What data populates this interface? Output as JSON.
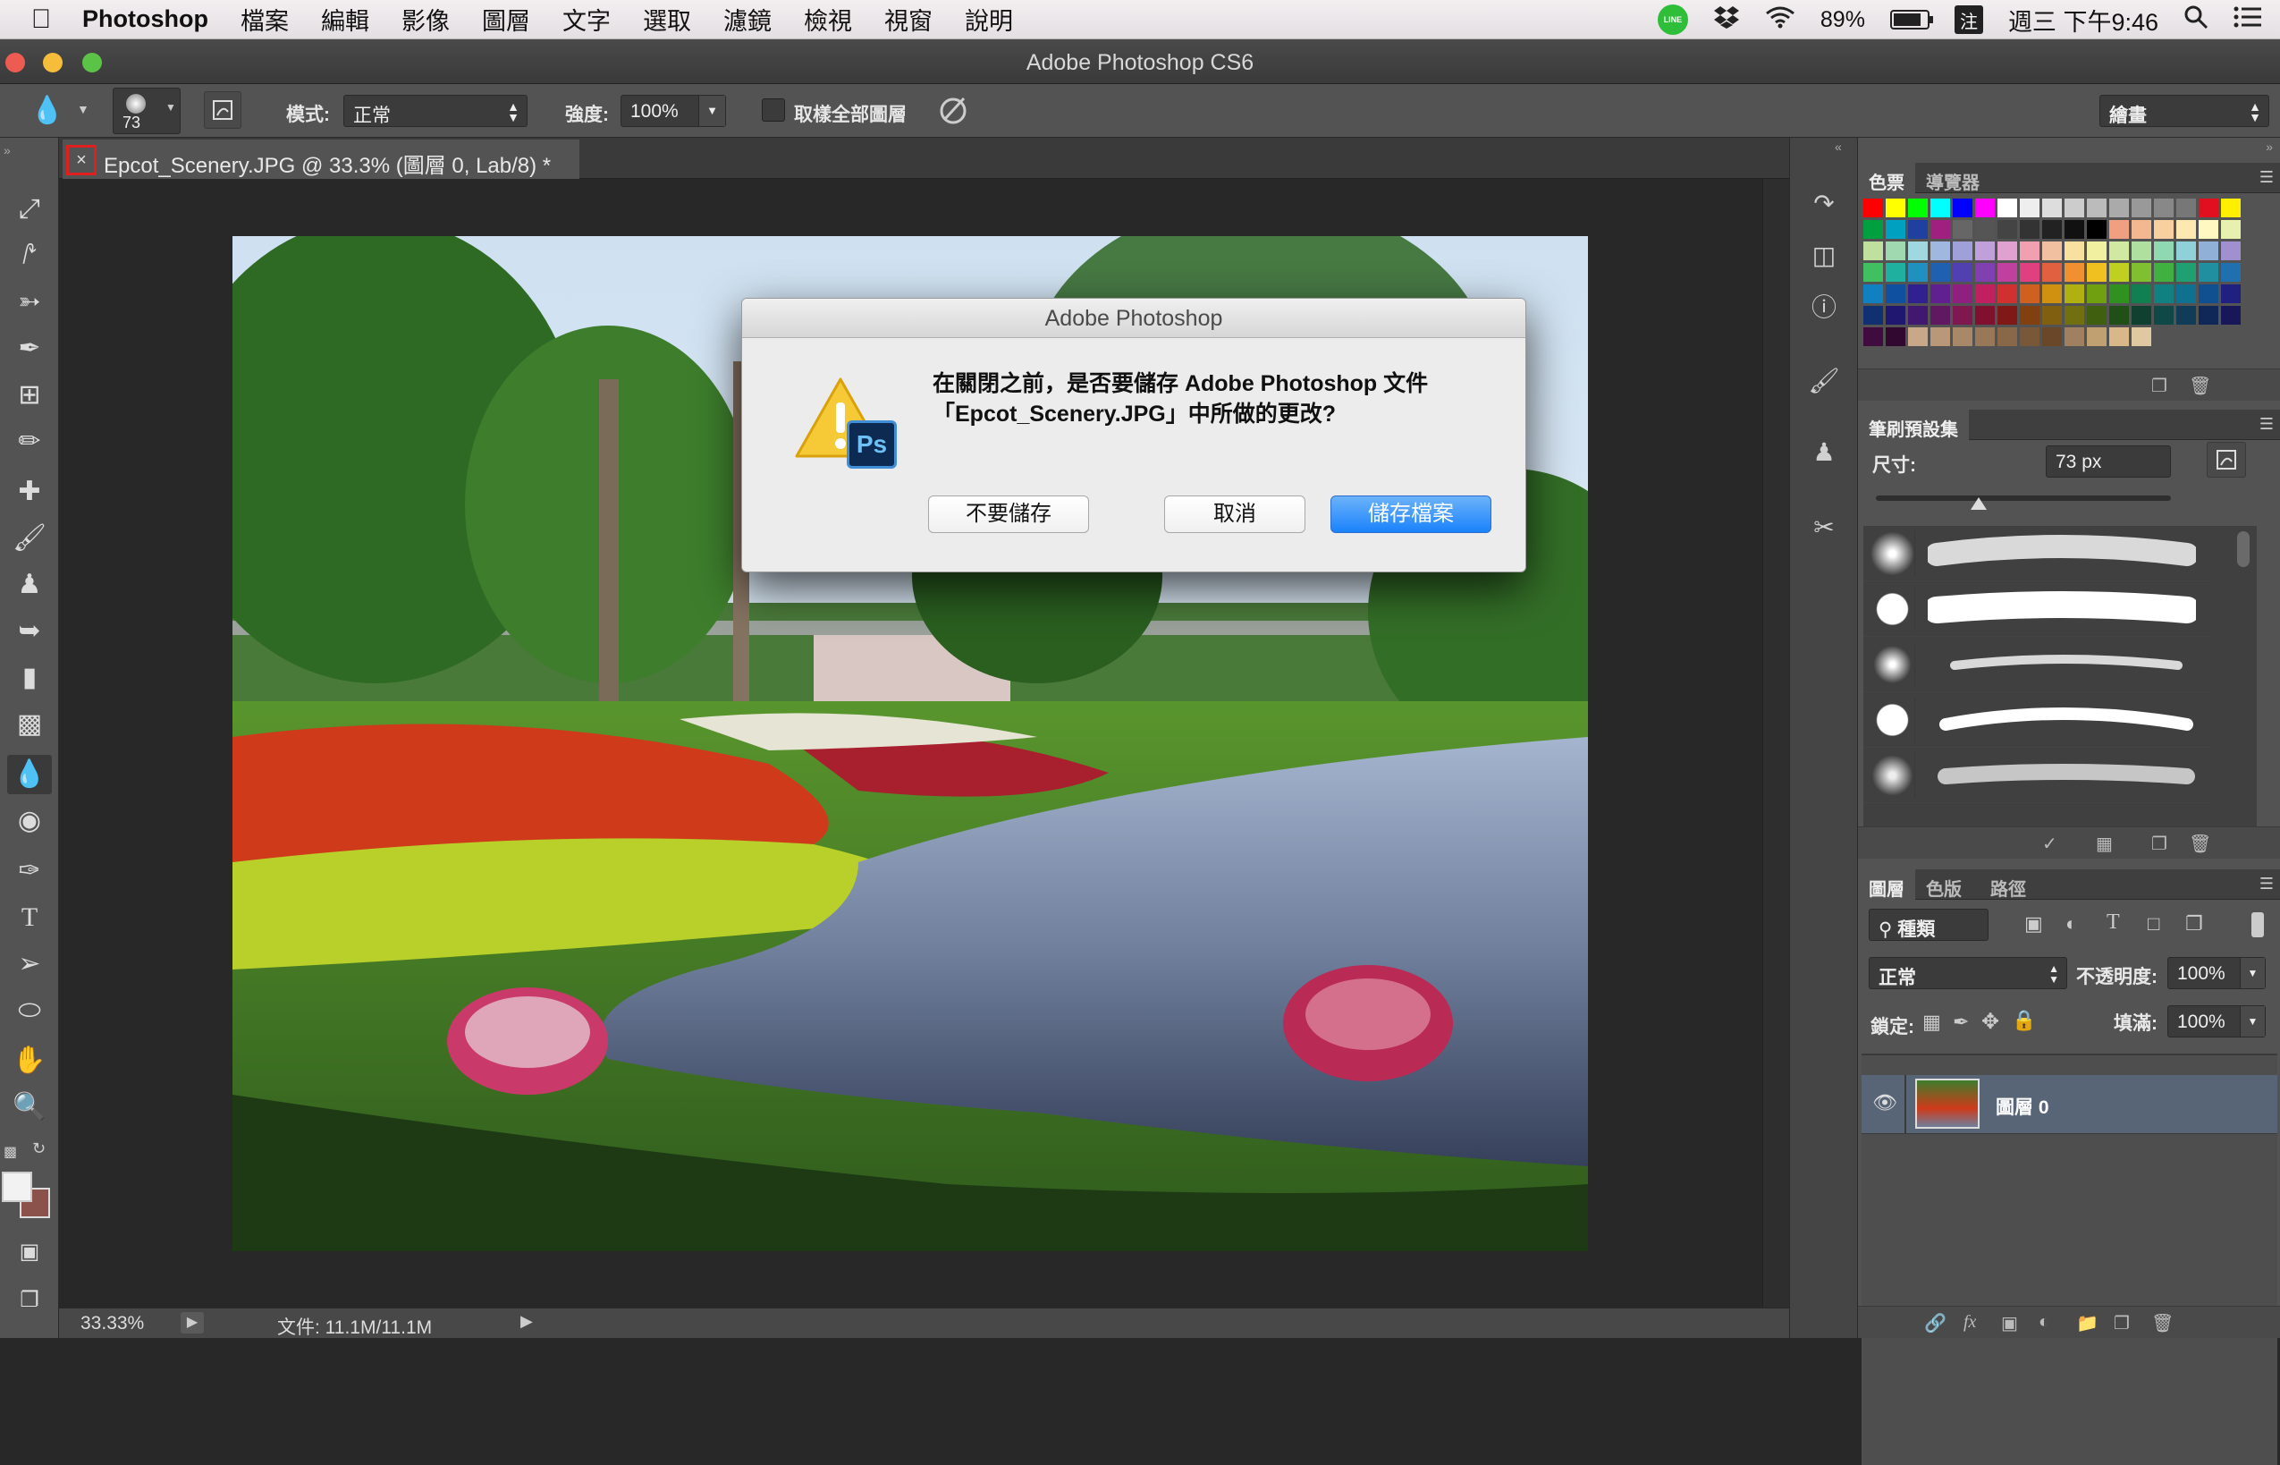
{
  "menubar": {
    "app_name": "Photoshop",
    "items": [
      "檔案",
      "編輯",
      "影像",
      "圖層",
      "文字",
      "選取",
      "濾鏡",
      "檢視",
      "視窗",
      "說明"
    ],
    "line_label": "LINE",
    "battery": "89%",
    "input_method": "注",
    "clock": "週三 下午9:46"
  },
  "window": {
    "title": "Adobe Photoshop CS6"
  },
  "options_bar": {
    "brush_size": "73",
    "mode_label": "模式:",
    "mode_value": "正常",
    "strength_label": "強度:",
    "strength_value": "100%",
    "sample_all_label": "取樣全部圖層",
    "workspace_value": "繪畫"
  },
  "document": {
    "tab_title": "Epcot_Scenery.JPG @ 33.3% (圖層 0, Lab/8) *",
    "close_glyph": "×"
  },
  "status_bar": {
    "zoom": "33.33%",
    "doc_info": "文件: 11.1M/11.1M"
  },
  "panels": {
    "swatches": {
      "tab_active": "色票",
      "tab_other": "導覽器"
    },
    "brush_presets": {
      "tab": "筆刷預設集",
      "size_label": "尺寸:",
      "size_value": "73 px"
    },
    "layers": {
      "tabs": [
        "圖層",
        "色版",
        "路徑"
      ],
      "filter_kind": "種類",
      "blend_mode": "正常",
      "opacity_label": "不透明度:",
      "opacity_value": "100%",
      "lock_label": "鎖定:",
      "fill_label": "填滿:",
      "fill_value": "100%",
      "layer_name": "圖層 0"
    }
  },
  "dialog": {
    "title": "Adobe Photoshop",
    "icon_badge": "Ps",
    "message_line1": "在關閉之前，是否要儲存 Adobe Photoshop 文件",
    "message_line2": "「Epcot_Scenery.JPG」中所做的更改?",
    "btn_dont_save": "不要儲存",
    "btn_cancel": "取消",
    "btn_save": "儲存檔案"
  }
}
